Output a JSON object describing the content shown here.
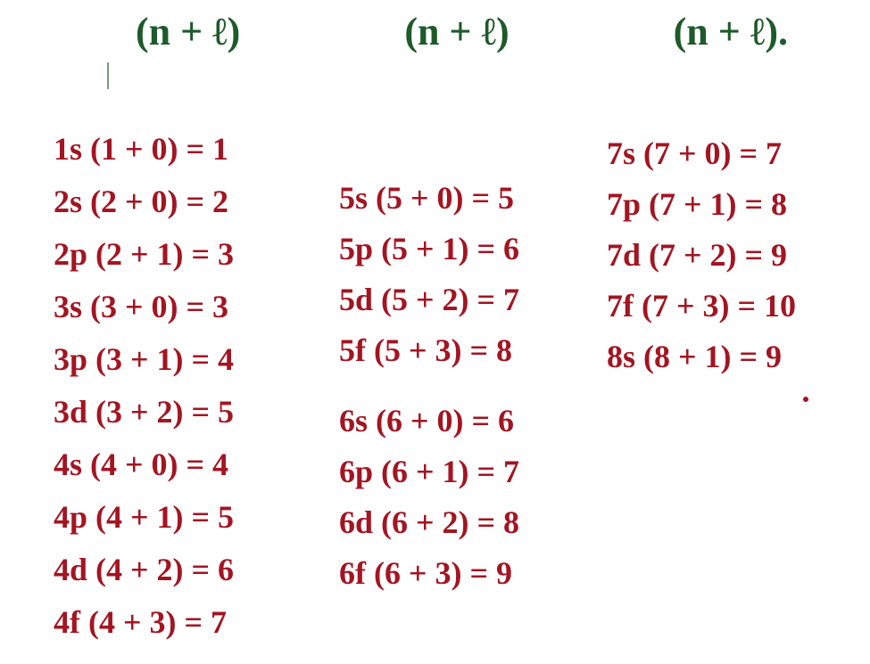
{
  "headers": [
    "(n + ℓ)",
    "(n + ℓ)",
    "(n + ℓ)."
  ],
  "col1": [
    "1s (1 + 0) = 1",
    "2s (2 + 0) = 2",
    "2p (2 + 1) = 3",
    "3s (3 + 0) = 3",
    "3p (3 + 1) = 4",
    "3d (3 + 2) = 5",
    "4s (4 + 0) = 4",
    "4p (4 + 1) = 5",
    "4d (4 + 2) = 6",
    "4f (4 + 3) = 7"
  ],
  "col2": [
    "5s (5 + 0) = 5",
    "5p (5 + 1) = 6",
    "5d (5 + 2) = 7",
    "5f (5 + 3) = 8",
    "",
    "6s (6 + 0) = 6",
    "6p (6 + 1) = 7",
    "6d (6 + 2) = 8",
    "6f (6 + 3) = 9"
  ],
  "col3": [
    "7s (7 + 0) = 7",
    "7p (7 + 1) = 8",
    "7d (7 + 2) = 9",
    "7f (7 + 3) = 10",
    "8s (8 + 1) = 9"
  ]
}
